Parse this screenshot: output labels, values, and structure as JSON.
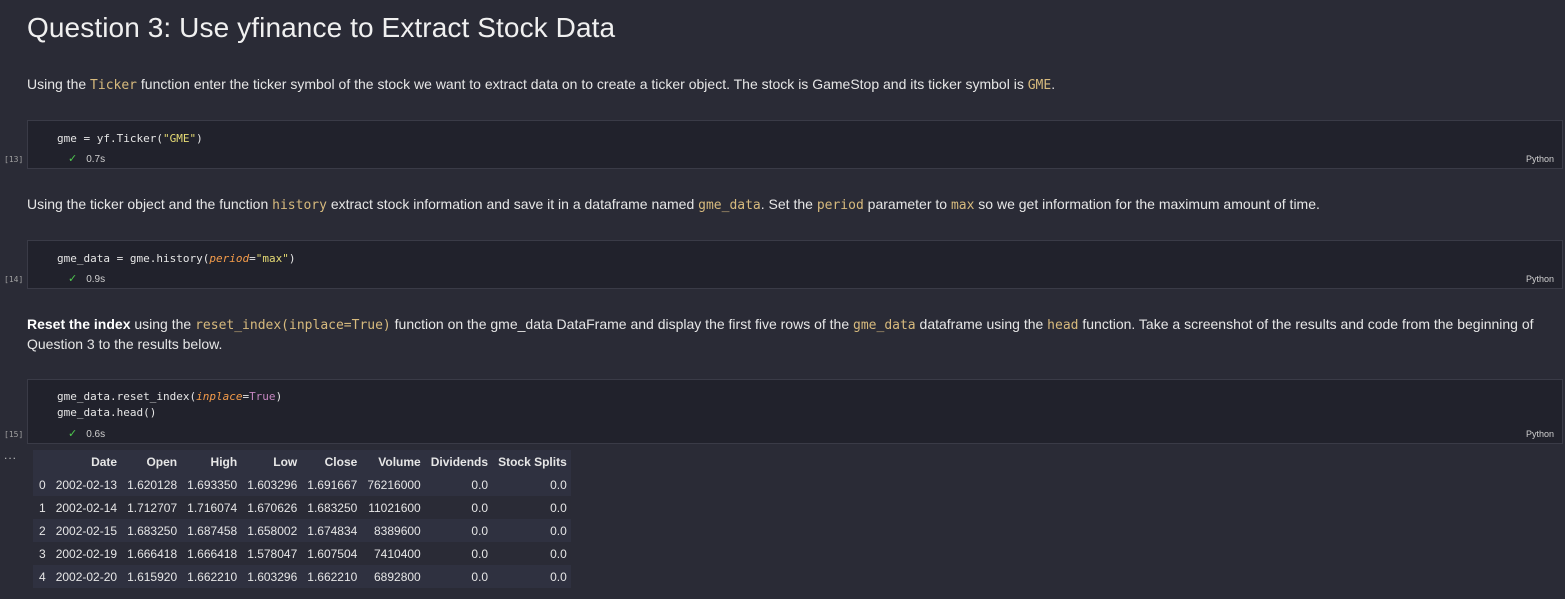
{
  "heading": "Question 3: Use yfinance to Extract Stock Data",
  "para1": {
    "t1": "Using the ",
    "c1": "Ticker",
    "t2": " function enter the ticker symbol of the stock we want to extract data on to create a ticker object. The stock is GameStop and its ticker symbol is ",
    "c2": "GME",
    "t3": "."
  },
  "cell13": {
    "exec": "[13]",
    "code_var": "gme",
    "code_rest": " = yf.Ticker(",
    "code_str": "\"GME\"",
    "code_end": ")",
    "time": "0.7s",
    "lang": "Python"
  },
  "para2": {
    "t1": "Using the ticker object and the function ",
    "c1": "history",
    "t2": " extract stock information and save it in a dataframe named ",
    "c2": "gme_data",
    "t3": ". Set the ",
    "c3": "period",
    "t4": " parameter to ",
    "c4": "max",
    "t5": " so we get information for the maximum amount of time."
  },
  "cell14": {
    "exec": "[14]",
    "code_a": "gme_data = gme.history(",
    "code_param": "period",
    "code_eq": "=",
    "code_str": "\"max\"",
    "code_end": ")",
    "time": "0.9s",
    "lang": "Python"
  },
  "para3": {
    "b1": "Reset the index",
    "t1": " using the ",
    "c1": "reset_index(inplace=True)",
    "t2": " function on the gme_data DataFrame and display the first five rows of the ",
    "c2": "gme_data",
    "t3": " dataframe using the ",
    "c3": "head",
    "t4": " function. Take a screenshot of the results and code from the beginning of Question 3 to the results below."
  },
  "cell15": {
    "exec": "[15]",
    "line1_a": "gme_data.reset_index(",
    "line1_param": "inplace",
    "line1_eq": "=",
    "line1_kw": "True",
    "line1_end": ")",
    "line2": "gme_data.head()",
    "time": "0.6s",
    "lang": "Python"
  },
  "output": {
    "ellipsis": "...",
    "columns": [
      "",
      "Date",
      "Open",
      "High",
      "Low",
      "Close",
      "Volume",
      "Dividends",
      "Stock Splits"
    ],
    "rows": [
      [
        "0",
        "2002-02-13",
        "1.620128",
        "1.693350",
        "1.603296",
        "1.691667",
        "76216000",
        "0.0",
        "0.0"
      ],
      [
        "1",
        "2002-02-14",
        "1.712707",
        "1.716074",
        "1.670626",
        "1.683250",
        "11021600",
        "0.0",
        "0.0"
      ],
      [
        "2",
        "2002-02-15",
        "1.683250",
        "1.687458",
        "1.658002",
        "1.674834",
        "8389600",
        "0.0",
        "0.0"
      ],
      [
        "3",
        "2002-02-19",
        "1.666418",
        "1.666418",
        "1.578047",
        "1.607504",
        "7410400",
        "0.0",
        "0.0"
      ],
      [
        "4",
        "2002-02-20",
        "1.615920",
        "1.662210",
        "1.603296",
        "1.662210",
        "6892800",
        "0.0",
        "0.0"
      ]
    ]
  }
}
